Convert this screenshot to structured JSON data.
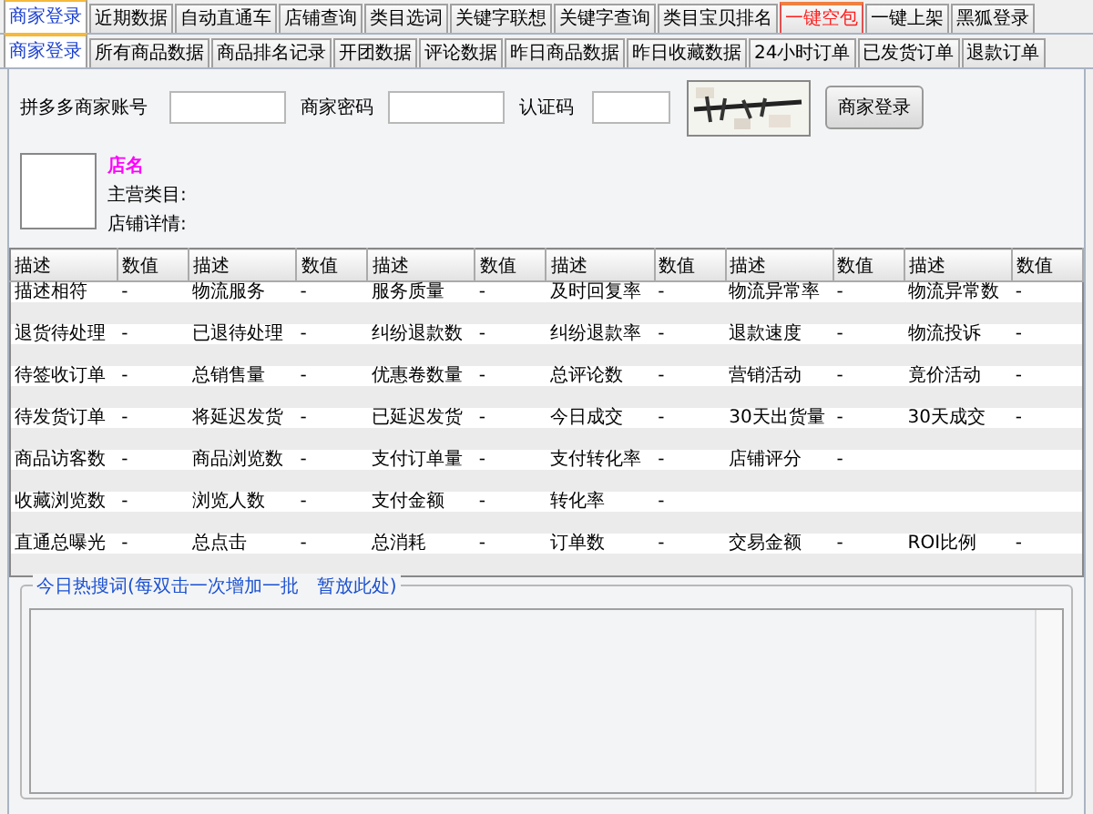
{
  "tabs": [
    {
      "label": "商家登录",
      "selected": true,
      "kind": "normal"
    },
    {
      "label": "近期数据",
      "selected": false,
      "kind": "normal"
    },
    {
      "label": "自动直通车",
      "selected": false,
      "kind": "normal"
    },
    {
      "label": "店铺查询",
      "selected": false,
      "kind": "normal"
    },
    {
      "label": "类目选词",
      "selected": false,
      "kind": "normal"
    },
    {
      "label": "关键字联想",
      "selected": false,
      "kind": "normal"
    },
    {
      "label": "关键字查询",
      "selected": false,
      "kind": "normal"
    },
    {
      "label": "类目宝贝排名",
      "selected": false,
      "kind": "normal"
    },
    {
      "label": "一键空包",
      "selected": false,
      "kind": "alert"
    },
    {
      "label": "一键上架",
      "selected": false,
      "kind": "normal"
    },
    {
      "label": "黑狐登录",
      "selected": false,
      "kind": "normal"
    }
  ],
  "subtabs": [
    {
      "label": "商家登录",
      "selected": true
    },
    {
      "label": "所有商品数据",
      "selected": false
    },
    {
      "label": "商品排名记录",
      "selected": false
    },
    {
      "label": "开团数据",
      "selected": false
    },
    {
      "label": "评论数据",
      "selected": false
    },
    {
      "label": "昨日商品数据",
      "selected": false
    },
    {
      "label": "昨日收藏数据",
      "selected": false
    },
    {
      "label": "24小时订单",
      "selected": false
    },
    {
      "label": "已发货订单",
      "selected": false
    },
    {
      "label": "退款订单",
      "selected": false
    }
  ],
  "login": {
    "account_label": "拼多多商家账号",
    "password_label": "商家密码",
    "captcha_label": "认证码",
    "button": "商家登录"
  },
  "shop": {
    "name": "店名",
    "category_label": "主营类目:",
    "detail_label": "店铺详情:"
  },
  "table": {
    "columns": [
      "描述",
      "数值",
      "描述",
      "数值",
      "描述",
      "数值",
      "描述",
      "数值",
      "描述",
      "数值",
      "描述",
      "数值"
    ],
    "rows": [
      [
        "描述相符",
        "-",
        "物流服务",
        "-",
        "服务质量",
        "-",
        "及时回复率",
        "-",
        "物流异常率",
        "-",
        "物流异常数",
        "-"
      ],
      [
        "退货待处理",
        "-",
        "已退待处理",
        "-",
        "纠纷退款数",
        "-",
        "纠纷退款率",
        "-",
        "退款速度",
        "-",
        "物流投诉",
        "-"
      ],
      [
        "待签收订单",
        "-",
        "总销售量",
        "-",
        "优惠卷数量",
        "-",
        "总评论数",
        "-",
        "营销活动",
        "-",
        "竟价活动",
        "-"
      ],
      [
        "待发货订单",
        "-",
        "将延迟发货",
        "-",
        "已延迟发货",
        "-",
        "今日成交",
        "-",
        "30天出货量",
        "-",
        "30天成交",
        "-"
      ],
      [
        "商品访客数",
        "-",
        "商品浏览数",
        "-",
        "支付订单量",
        "-",
        "支付转化率",
        "-",
        "店铺评分",
        "-",
        null,
        null
      ],
      [
        "收藏浏览数",
        "-",
        "浏览人数",
        "-",
        "支付金额",
        "-",
        "转化率",
        "-",
        null,
        null,
        null,
        null
      ],
      [
        "直通总曝光",
        "-",
        "总点击",
        "-",
        "总消耗",
        "-",
        "订单数",
        "-",
        "交易金额",
        "-",
        "ROI比例",
        "-"
      ]
    ]
  },
  "hot_words": {
    "title": "今日热搜词(每双击一次增加一批　暂放此处)"
  }
}
